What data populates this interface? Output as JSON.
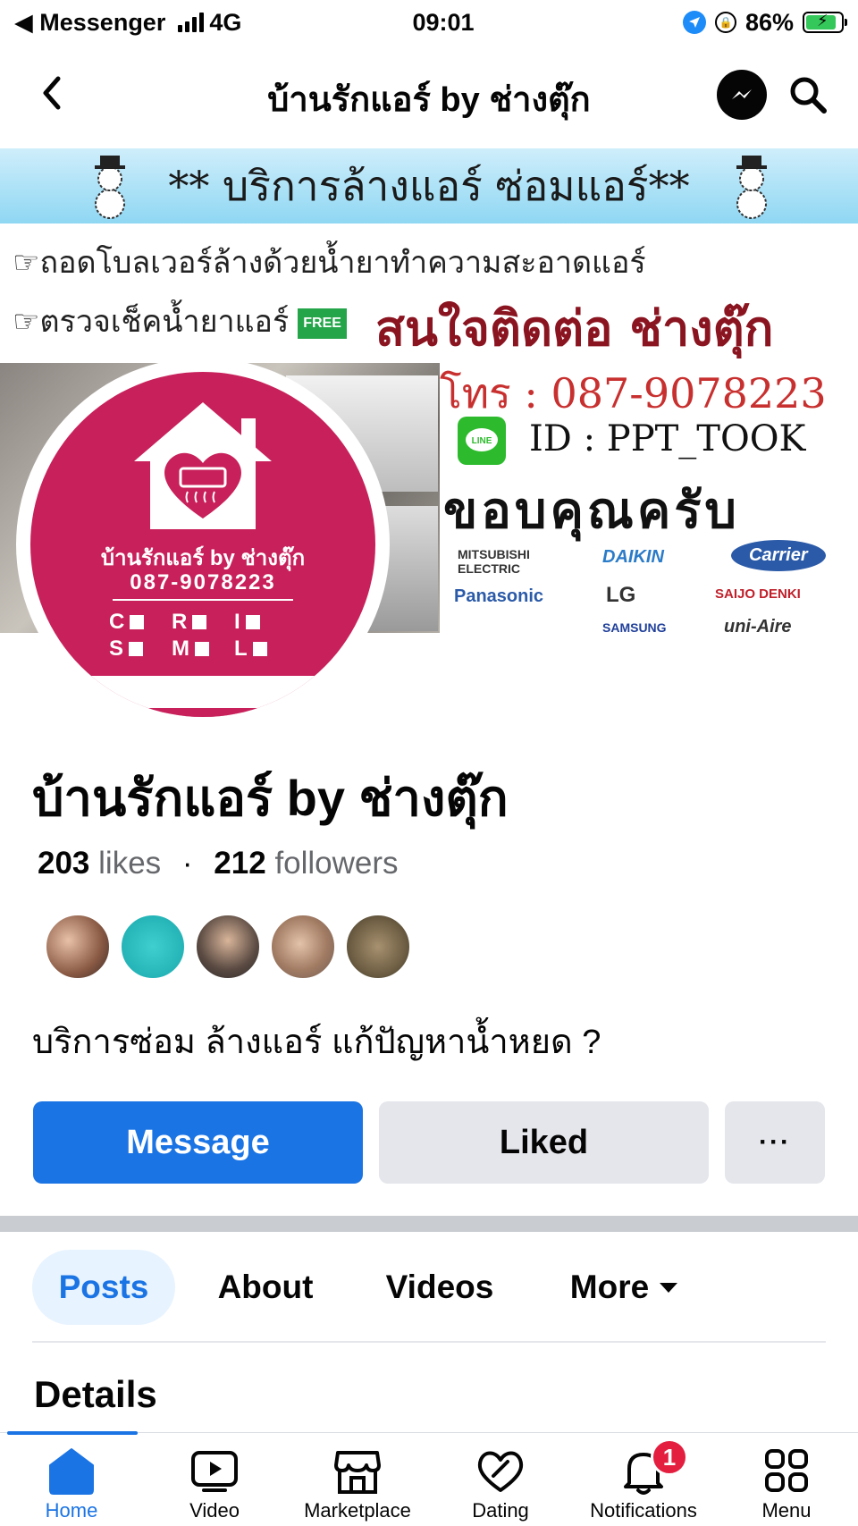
{
  "status_bar": {
    "back_app": "◀ Messenger",
    "network": "4G",
    "time": "09:01",
    "battery": "86%",
    "battery_level": 0.86
  },
  "header": {
    "title": "บ้านรักแอร์ by ช่างตุ๊ก"
  },
  "cover": {
    "banner": "** บริการล้างแอร์ ซ่อมแอร์**",
    "line1": "☞ถอดโบลเวอร์ล้างด้วยน้ำยาทำความสะอาดแอร์",
    "line2": "☞ตรวจเช็คน้ำยาแอร์",
    "free_badge": "FREE",
    "contact_heading": "สนใจติดต่อ ช่างตุ๊ก",
    "phone": "โทร : 087-9078223",
    "line_icon_text": "LINE",
    "line_id": "ID : PPT_TOOK",
    "thanks": "ขอบคุณครับ",
    "brands": [
      "MITSUBISHI ELECTRIC",
      "DAIKIN",
      "Carrier",
      "Panasonic",
      "LG",
      "SAIJO DENKI",
      "SAMSUNG",
      "uni-Aire"
    ]
  },
  "profile_picture": {
    "name": "บ้านรักแอร์ by ช่างตุ๊ก",
    "phone": "087-9078223",
    "grid": [
      "C",
      "R",
      "I",
      "S",
      "M",
      "L"
    ]
  },
  "page": {
    "name": "บ้านรักแอร์ by ช่างตุ๊ก",
    "likes_count": "203",
    "likes_label": "likes",
    "separator": "·",
    "followers_count": "212",
    "followers_label": "followers",
    "bio": "บริการซ่อม ล้างแอร์ แก้ปัญหาน้ำหยด ?"
  },
  "actions": {
    "message": "Message",
    "liked": "Liked",
    "more": "···"
  },
  "tabs": [
    "Posts",
    "About",
    "Videos",
    "More"
  ],
  "section": {
    "details": "Details"
  },
  "bottom_nav": {
    "home": "Home",
    "video": "Video",
    "marketplace": "Marketplace",
    "dating": "Dating",
    "notifications": "Notifications",
    "notifications_badge": "1",
    "menu": "Menu"
  },
  "colors": {
    "accent": "#1b74e4",
    "avatar_bg": "#c8205a",
    "button_gray": "#e4e6eb",
    "badge_red": "#e41e3f"
  }
}
